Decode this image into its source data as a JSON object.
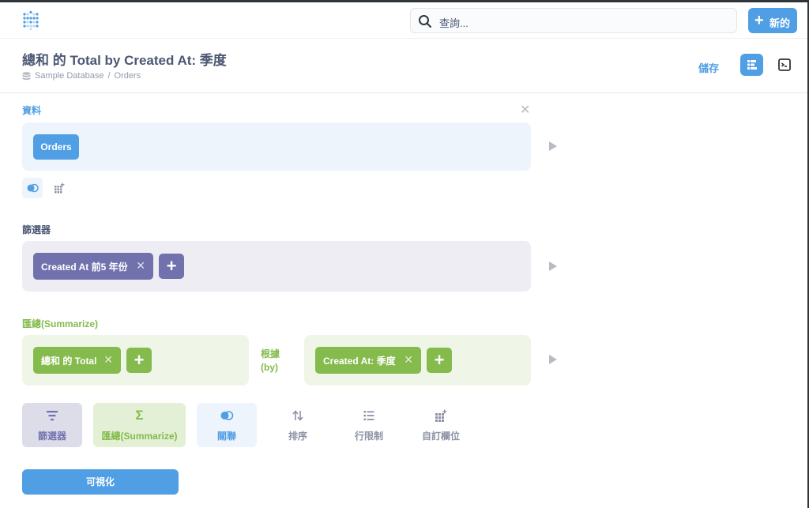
{
  "nav": {
    "search_placeholder": "查詢...",
    "new_label": "新的"
  },
  "header": {
    "title": "總和 的 Total by Created At: 季度",
    "breadcrumb": [
      "Sample Database",
      "/",
      "Orders"
    ],
    "save_label": "儲存"
  },
  "editor": {
    "data_label": "資料",
    "data_source": "Orders",
    "filter_label": "篩選器",
    "filter_pill": "Created At 前5 年份",
    "summarize_label": "匯總(Summarize)",
    "metric_pill": "總和 的 Total",
    "by_label_1": "根據",
    "by_label_2": "(by)",
    "group_pill": "Created At: 季度"
  },
  "actions": {
    "filter": "篩選器",
    "summarize": "匯總(Summarize)",
    "join": "關聯",
    "sort": "排序",
    "limit": "行限制",
    "custom_column": "自訂欄位"
  },
  "visualize_label": "可視化",
  "colors": {
    "brand": "#509ee3",
    "filter": "#7172ad",
    "summarize": "#84bb4c"
  }
}
